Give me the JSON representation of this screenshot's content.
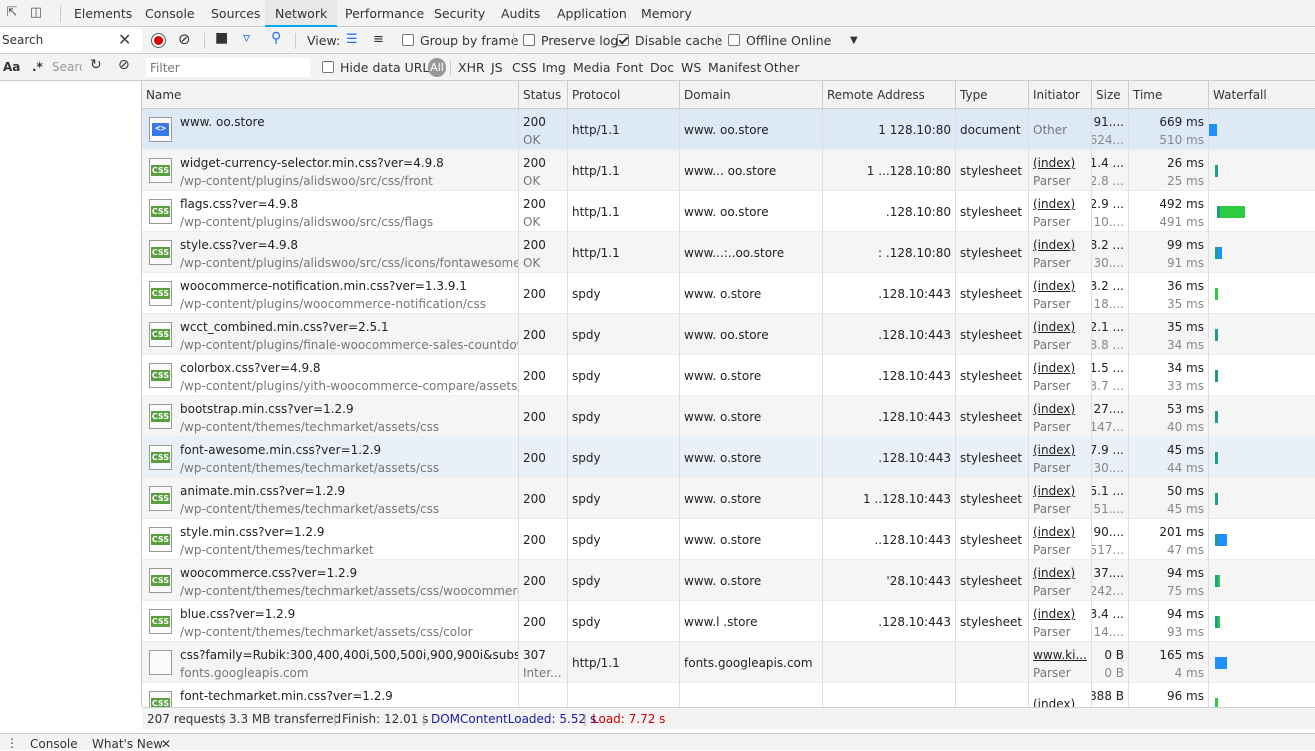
{
  "tabs": [
    {
      "label": "Elements"
    },
    {
      "label": "Console"
    },
    {
      "label": "Sources"
    },
    {
      "label": "Network"
    },
    {
      "label": "Performance"
    },
    {
      "label": "Security"
    },
    {
      "label": "Audits"
    },
    {
      "label": "Application"
    },
    {
      "label": "Memory"
    }
  ],
  "active_tab": "Network",
  "search": {
    "label": "Search",
    "placeholder": "Search",
    "regex": ".*",
    "case": "Aa"
  },
  "toolbar": {
    "view_label": "View:",
    "group_by_frame": "Group by frame",
    "preserve_log": "Preserve log",
    "disable_cache": "Disable cache",
    "offline": "Offline",
    "throttle": "Online",
    "disable_cache_checked": true
  },
  "filter": {
    "placeholder": "Filter",
    "hide_data_urls": "Hide data URLs",
    "types": [
      "All",
      "XHR",
      "JS",
      "CSS",
      "Img",
      "Media",
      "Font",
      "Doc",
      "WS",
      "Manifest",
      "Other"
    ]
  },
  "columns": [
    "Name",
    "Status",
    "Protocol",
    "Domain",
    "Remote Address",
    "Type",
    "Initiator",
    "Size",
    "Time",
    "Waterfall"
  ],
  "rows": [
    {
      "icon": "doc",
      "name": "www.        oo.store",
      "path": "",
      "status": "200",
      "status_text": "OK",
      "protocol": "http/1.1",
      "domain": "www.      oo.store",
      "remote": "1           128.10:80",
      "type": "document",
      "initiator": "Other",
      "initiator2": "",
      "size1": "91....",
      "size2": "624...",
      "time1": "669 ms",
      "time2": "510 ms",
      "wf": [
        {
          "l": 6,
          "w": 30,
          "c": "#2ecc40"
        },
        {
          "l": 36,
          "w": 8,
          "c": "#1e90ff"
        }
      ]
    },
    {
      "icon": "css",
      "name": "widget-currency-selector.min.css?ver=4.9.8",
      "path": "/wp-content/plugins/alidswoo/src/css/front",
      "status": "200",
      "status_text": "OK",
      "protocol": "http/1.1",
      "domain": "www...     oo.store",
      "remote": "1       ...128.10:80",
      "type": "stylesheet",
      "initiator": "(index)",
      "initiator2": "Parser",
      "size1": "1.4 ...",
      "size2": "2.8 ...",
      "time1": "26 ms",
      "time2": "25 ms",
      "wf": [
        {
          "l": 42,
          "w": 3,
          "c": "#1a9e8f"
        }
      ]
    },
    {
      "icon": "css",
      "name": "flags.css?ver=4.9.8",
      "path": "/wp-content/plugins/alidswoo/src/css/flags",
      "status": "200",
      "status_text": "OK",
      "protocol": "http/1.1",
      "domain": "www.      oo.store",
      "remote": "            .128.10:80",
      "type": "stylesheet",
      "initiator": "(index)",
      "initiator2": "Parser",
      "size1": "2.9 ...",
      "size2": "10....",
      "time1": "492 ms",
      "time2": "491 ms",
      "wf": [
        {
          "l": 44,
          "w": 3,
          "c": "#1a9e8f"
        },
        {
          "l": 47,
          "w": 25,
          "c": "#2ecc40"
        }
      ]
    },
    {
      "icon": "css",
      "name": "style.css?ver=4.9.8",
      "path": "/wp-content/plugins/alidswoo/src/css/icons/fontawesome",
      "status": "200",
      "status_text": "OK",
      "protocol": "http/1.1",
      "domain": "www...:..oo.store",
      "remote": "    :      .128.10:80",
      "type": "stylesheet",
      "initiator": "(index)",
      "initiator2": "Parser",
      "size1": "8.2 ...",
      "size2": "30....",
      "time1": "99 ms",
      "time2": "91 ms",
      "wf": [
        {
          "l": 42,
          "w": 3,
          "c": "#1a9e8f"
        },
        {
          "l": 45,
          "w": 4,
          "c": "#1e90ff"
        }
      ]
    },
    {
      "icon": "css",
      "name": "woocommerce-notification.min.css?ver=1.3.9.1",
      "path": "/wp-content/plugins/woocommerce-notification/css",
      "status": "200",
      "status_text": "",
      "protocol": "spdy",
      "domain": "www.       o.store",
      "remote": "            .128.10:443",
      "type": "stylesheet",
      "initiator": "(index)",
      "initiator2": "Parser",
      "size1": "3.2 ...",
      "size2": "18....",
      "time1": "36 ms",
      "time2": "35 ms",
      "wf": [
        {
          "l": 42,
          "w": 3,
          "c": "#2ecc40"
        }
      ]
    },
    {
      "icon": "css",
      "name": "wcct_combined.min.css?ver=2.5.1",
      "path": "/wp-content/plugins/finale-woocommerce-sales-countdown-...",
      "status": "200",
      "status_text": "",
      "protocol": "spdy",
      "domain": "www.      oo.store",
      "remote": "            .128.10:443",
      "type": "stylesheet",
      "initiator": "(index)",
      "initiator2": "Parser",
      "size1": "2.1 ...",
      "size2": "8.8 ...",
      "time1": "35 ms",
      "time2": "34 ms",
      "wf": [
        {
          "l": 42,
          "w": 3,
          "c": "#1a9e8f"
        }
      ]
    },
    {
      "icon": "css",
      "name": "colorbox.css?ver=4.9.8",
      "path": "/wp-content/plugins/yith-woocommerce-compare/assets/css",
      "status": "200",
      "status_text": "",
      "protocol": "spdy",
      "domain": "www.       o.store",
      "remote": "            .128.10:443",
      "type": "stylesheet",
      "initiator": "(index)",
      "initiator2": "Parser",
      "size1": "1.5 ...",
      "size2": "3.7 ...",
      "time1": "34 ms",
      "time2": "33 ms",
      "wf": [
        {
          "l": 42,
          "w": 3,
          "c": "#1a9e8f"
        }
      ]
    },
    {
      "icon": "css",
      "name": "bootstrap.min.css?ver=1.2.9",
      "path": "/wp-content/themes/techmarket/assets/css",
      "status": "200",
      "status_text": "",
      "protocol": "spdy",
      "domain": "www.       o.store",
      "remote": "            .128.10:443",
      "type": "stylesheet",
      "initiator": "(index)",
      "initiator2": "Parser",
      "size1": "27....",
      "size2": "147...",
      "time1": "53 ms",
      "time2": "40 ms",
      "wf": [
        {
          "l": 42,
          "w": 3,
          "c": "#1a9e8f"
        }
      ]
    },
    {
      "icon": "css",
      "name": "font-awesome.min.css?ver=1.2.9",
      "path": "/wp-content/themes/techmarket/assets/css",
      "status": "200",
      "status_text": "",
      "protocol": "spdy",
      "domain": "www.       o.store",
      "remote": "            .128.10:443",
      "type": "stylesheet",
      "initiator": "(index)",
      "initiator2": "Parser",
      "size1": "7.9 ...",
      "size2": "30....",
      "time1": "45 ms",
      "time2": "44 ms",
      "wf": [
        {
          "l": 42,
          "w": 3,
          "c": "#1a9e8f"
        }
      ]
    },
    {
      "icon": "css",
      "name": "animate.min.css?ver=1.2.9",
      "path": "/wp-content/themes/techmarket/assets/css",
      "status": "200",
      "status_text": "",
      "protocol": "spdy",
      "domain": "www.       o.store",
      "remote": "1       ..128.10:443",
      "type": "stylesheet",
      "initiator": "(index)",
      "initiator2": "Parser",
      "size1": "5.1 ...",
      "size2": "51....",
      "time1": "50 ms",
      "time2": "45 ms",
      "wf": [
        {
          "l": 42,
          "w": 3,
          "c": "#1a9e8f"
        }
      ]
    },
    {
      "icon": "css",
      "name": "style.min.css?ver=1.2.9",
      "path": "/wp-content/themes/techmarket",
      "status": "200",
      "status_text": "",
      "protocol": "spdy",
      "domain": "www.       o.store",
      "remote": "         ..128.10:443",
      "type": "stylesheet",
      "initiator": "(index)",
      "initiator2": "Parser",
      "size1": "90....",
      "size2": "517...",
      "time1": "201 ms",
      "time2": "47 ms",
      "wf": [
        {
          "l": 42,
          "w": 3,
          "c": "#1a9e8f"
        },
        {
          "l": 45,
          "w": 9,
          "c": "#1e90ff"
        }
      ]
    },
    {
      "icon": "css",
      "name": "woocommerce.css?ver=1.2.9",
      "path": "/wp-content/themes/techmarket/assets/css/woocommerce",
      "status": "200",
      "status_text": "",
      "protocol": "spdy",
      "domain": "www.       o.store",
      "remote": "           '28.10:443",
      "type": "stylesheet",
      "initiator": "(index)",
      "initiator2": "Parser",
      "size1": "37....",
      "size2": "242...",
      "time1": "94 ms",
      "time2": "75 ms",
      "wf": [
        {
          "l": 42,
          "w": 3,
          "c": "#1a9e8f"
        },
        {
          "l": 45,
          "w": 2,
          "c": "#2ecc40"
        }
      ]
    },
    {
      "icon": "css",
      "name": "blue.css?ver=1.2.9",
      "path": "/wp-content/themes/techmarket/assets/css/color",
      "status": "200",
      "status_text": "",
      "protocol": "spdy",
      "domain": "www.l     .store",
      "remote": "            .128.10:443",
      "type": "stylesheet",
      "initiator": "(index)",
      "initiator2": "Parser",
      "size1": "3.4 ...",
      "size2": "14....",
      "time1": "94 ms",
      "time2": "93 ms",
      "wf": [
        {
          "l": 42,
          "w": 3,
          "c": "#1a9e8f"
        },
        {
          "l": 45,
          "w": 2,
          "c": "#2ecc40"
        }
      ]
    },
    {
      "icon": "blank",
      "name": "css?family=Rubik:300,400,400i,500,500i,900,900i&subset=lati...",
      "path": "fonts.googleapis.com",
      "status": "307",
      "status_text": "Inter...",
      "protocol": "http/1.1",
      "domain": "fonts.googleapis.com",
      "remote": "",
      "type": "",
      "initiator": "www.ki...",
      "initiator2": "Parser",
      "size1": "0 B",
      "size2": "0 B",
      "time1": "165 ms",
      "time2": "4 ms",
      "wf": [
        {
          "l": 42,
          "w": 12,
          "c": "#1e90ff"
        }
      ]
    },
    {
      "icon": "css",
      "name": "font-techmarket.min.css?ver=1.2.9",
      "path": "",
      "status": "",
      "status_text": "",
      "protocol": "",
      "domain": "",
      "remote": "",
      "type": "",
      "initiator": "(index)",
      "initiator2": "",
      "size1": "888 B",
      "size2": "",
      "time1": "96 ms",
      "time2": "",
      "wf": [
        {
          "l": 42,
          "w": 3,
          "c": "#2ecc40"
        }
      ]
    }
  ],
  "status": {
    "requests": "207 requests",
    "transferred": "3.3 MB transferred",
    "finish": "Finish: 12.01 s",
    "dcl": "DOMContentLoaded: 5.52 s",
    "load": "Load: 7.72 s"
  },
  "drawer": {
    "console": "Console",
    "whats_new": "What's New"
  }
}
